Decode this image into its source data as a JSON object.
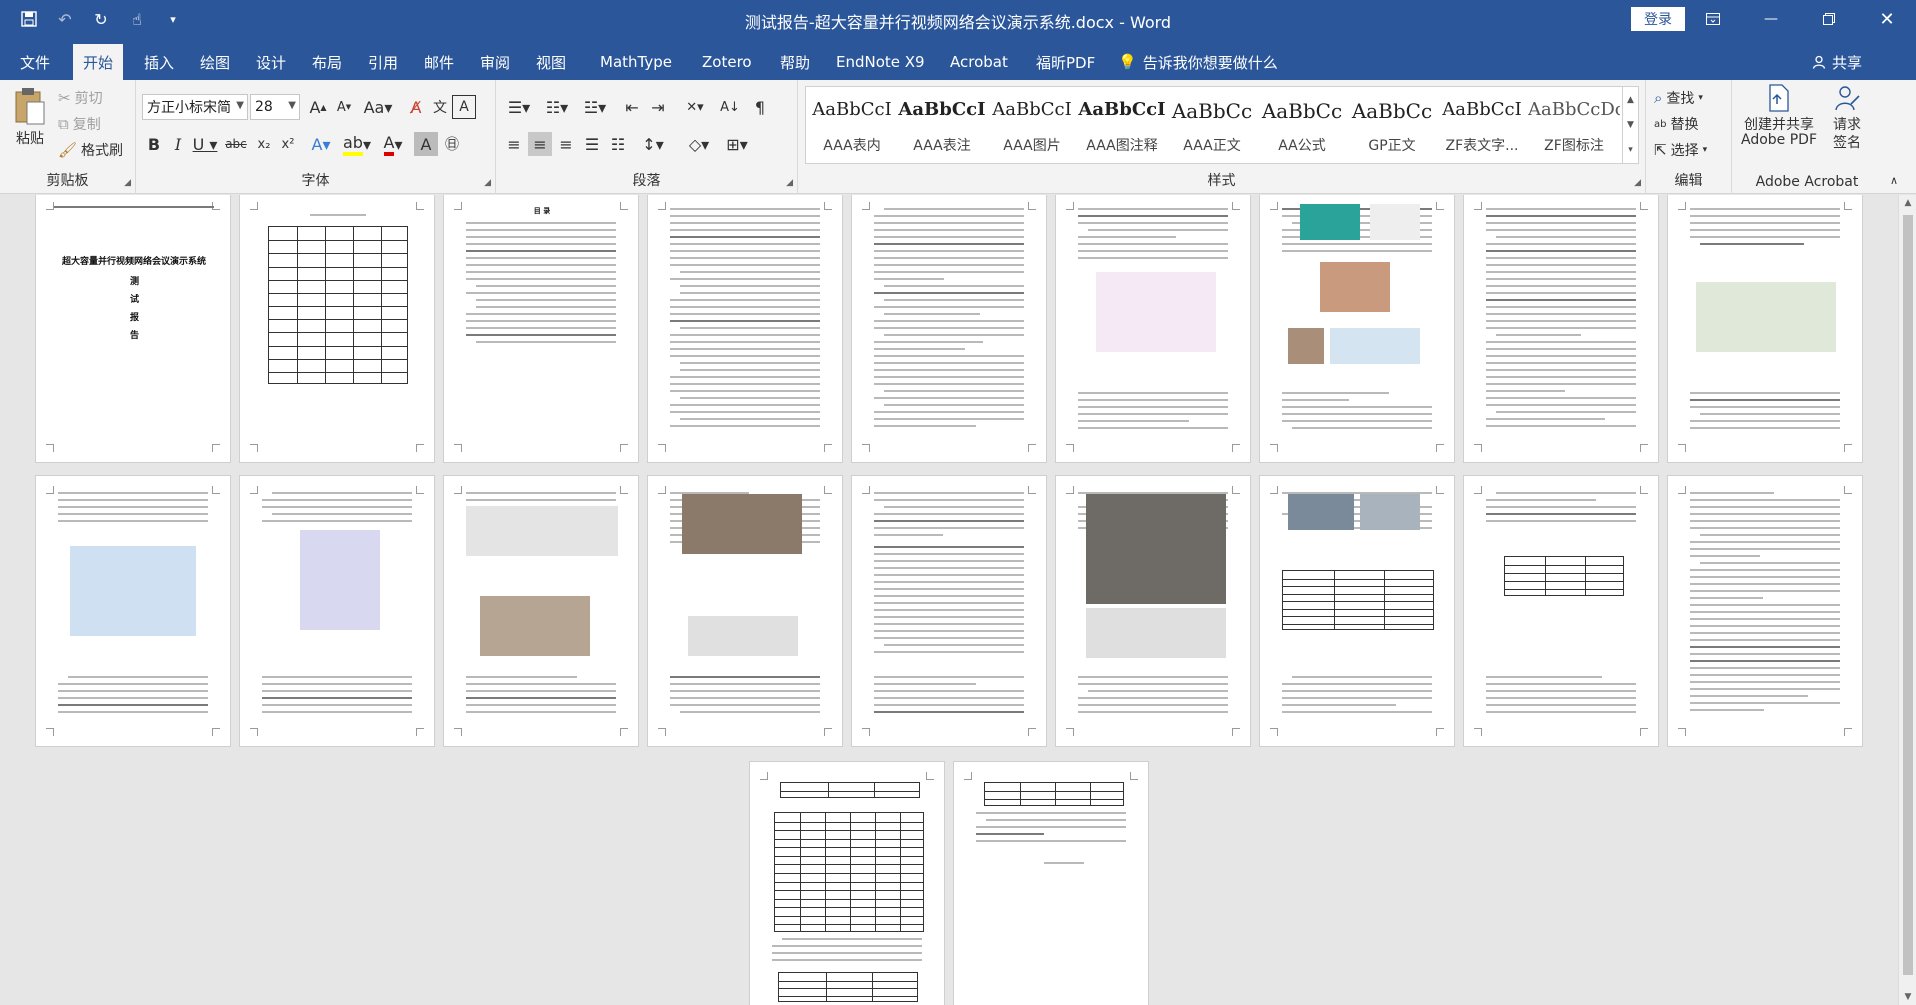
{
  "window": {
    "title": "测试报告-超大容量并行视频网络会议演示系统.docx  -  Word",
    "login_label": "登录"
  },
  "menu": {
    "tabs": [
      "文件",
      "开始",
      "插入",
      "绘图",
      "设计",
      "布局",
      "引用",
      "邮件",
      "审阅",
      "视图",
      "MathType",
      "Zotero",
      "帮助",
      "EndNote X9",
      "Acrobat",
      "福昕PDF"
    ],
    "active_tab": "开始",
    "tell_me": "告诉我你想要做什么",
    "share": "共享"
  },
  "ribbon": {
    "clipboard": {
      "label": "剪贴板",
      "paste": "粘贴",
      "cut": "剪切",
      "copy": "复制",
      "format_painter": "格式刷"
    },
    "font": {
      "label": "字体",
      "font_name": "方正小标宋简",
      "font_size": "28"
    },
    "paragraph": {
      "label": "段落"
    },
    "styles": {
      "label": "样式",
      "items": [
        {
          "preview": "AaBbCcI",
          "name": "AAA表内"
        },
        {
          "preview": "AaBbCcI",
          "name": "AAA表注"
        },
        {
          "preview": "AaBbCcI",
          "name": "AAA图片"
        },
        {
          "preview": "AaBbCcI",
          "name": "AAA图注释"
        },
        {
          "preview": "AaBbCc",
          "name": "AAA正文"
        },
        {
          "preview": "AaBbCc",
          "name": "AA公式"
        },
        {
          "preview": "AaBbCc",
          "name": "GP正文"
        },
        {
          "preview": "AaBbCcI",
          "name": "ZF表文字..."
        },
        {
          "preview": "AaBbCcDc",
          "name": "ZF图标注"
        }
      ]
    },
    "editing": {
      "label": "编辑",
      "find": "查找",
      "replace": "替换",
      "select": "选择"
    },
    "acrobat": {
      "label": "Adobe Acrobat",
      "create": "创建并共享\nAdobe PDF",
      "create_line1": "创建并共享",
      "create_line2": "Adobe PDF",
      "sign_line1": "请求",
      "sign_line2": "签名"
    }
  },
  "pages": {
    "cover": {
      "title": "超大容量并行视频网络会议演示系统",
      "chars": [
        "测",
        "试",
        "报",
        "告"
      ]
    },
    "toc_title": "目  录"
  }
}
